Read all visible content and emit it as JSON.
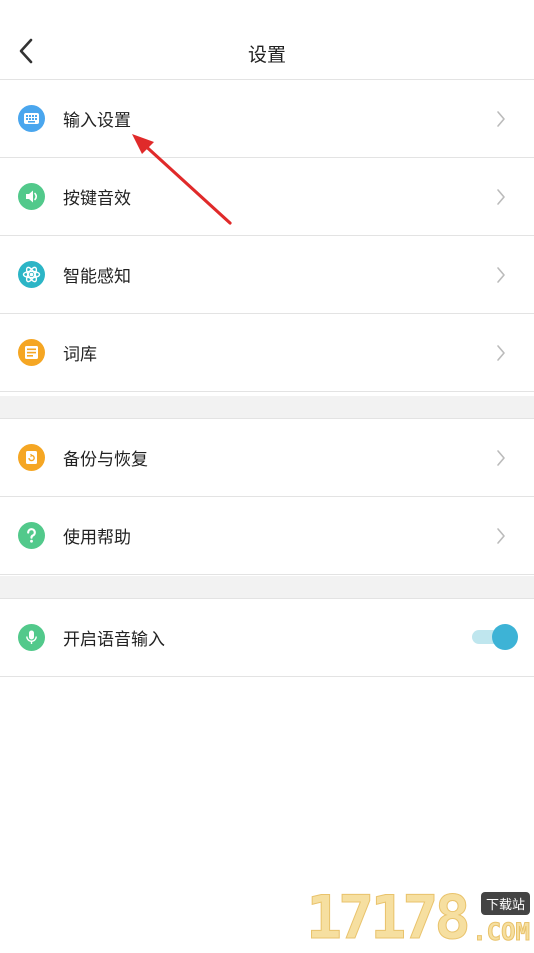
{
  "header": {
    "title": "设置"
  },
  "groups": [
    {
      "items": [
        {
          "label": "输入设置",
          "icon": "keyboard-icon",
          "color": "#4aa6ee"
        },
        {
          "label": "按键音效",
          "icon": "speaker-icon",
          "color": "#52c98b"
        },
        {
          "label": "智能感知",
          "icon": "atom-icon",
          "color": "#2cb5c6"
        },
        {
          "label": "词库",
          "icon": "dictionary-icon",
          "color": "#f5a623"
        }
      ]
    },
    {
      "items": [
        {
          "label": "备份与恢复",
          "icon": "backup-icon",
          "color": "#f5a623"
        },
        {
          "label": "使用帮助",
          "icon": "help-icon",
          "color": "#52c98b"
        }
      ]
    },
    {
      "items": [
        {
          "label": "开启语音输入",
          "icon": "microphone-icon",
          "color": "#52c98b",
          "toggle_on": true
        }
      ]
    }
  ],
  "watermark": {
    "digits": "17178",
    "badge": "下载站",
    "domain": ".COM"
  }
}
